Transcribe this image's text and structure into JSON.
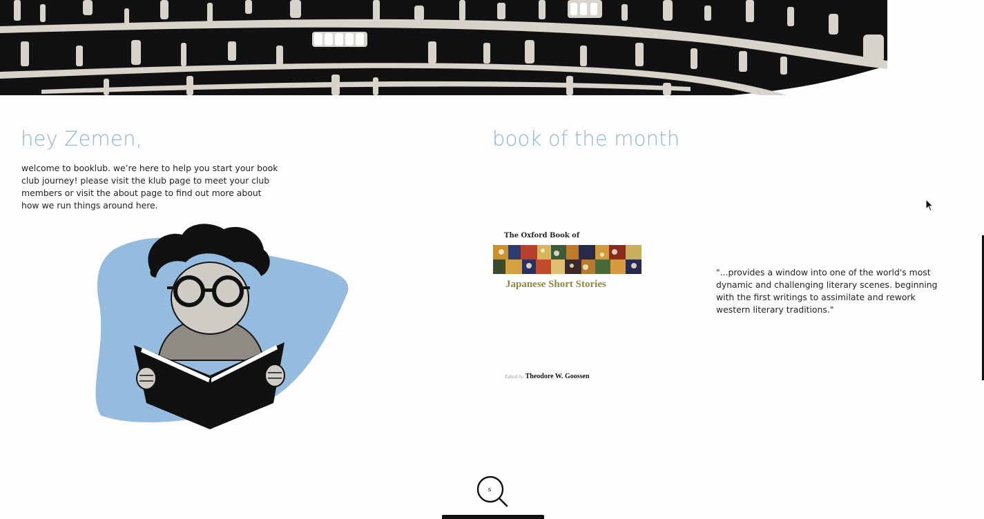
{
  "welcome": {
    "greeting": "hey Zemen,",
    "body": "welcome to booklub. we’re here to help you start your book club journey! please visit the klub page to meet your club members or visit the about page to find out more about how we run things around here."
  },
  "book_of_month": {
    "heading": "book of the month",
    "cover": {
      "top_line": "The Oxford Book of",
      "title": "Japanese Short Stories",
      "editor_prefix": "Edited by",
      "editor_name": "Theodore W. Goossen"
    },
    "quote": "\"...provides a window into one of the world's most dynamic and challenging literary scenes. beginning with the first writings to assimilate and rework western literary traditions.\""
  },
  "search": {
    "letter": "s"
  },
  "icons": {
    "banner": "bookshelf-banner-illustration",
    "reader": "reading-person-illustration",
    "search": "magnifier-icon",
    "cursor": "mouse-pointer-icon"
  },
  "colors": {
    "accent_blue": "#8fb3d3",
    "blob_blue": "#95bcdf",
    "ink": "#111111",
    "paper": "#d8d4cb"
  }
}
